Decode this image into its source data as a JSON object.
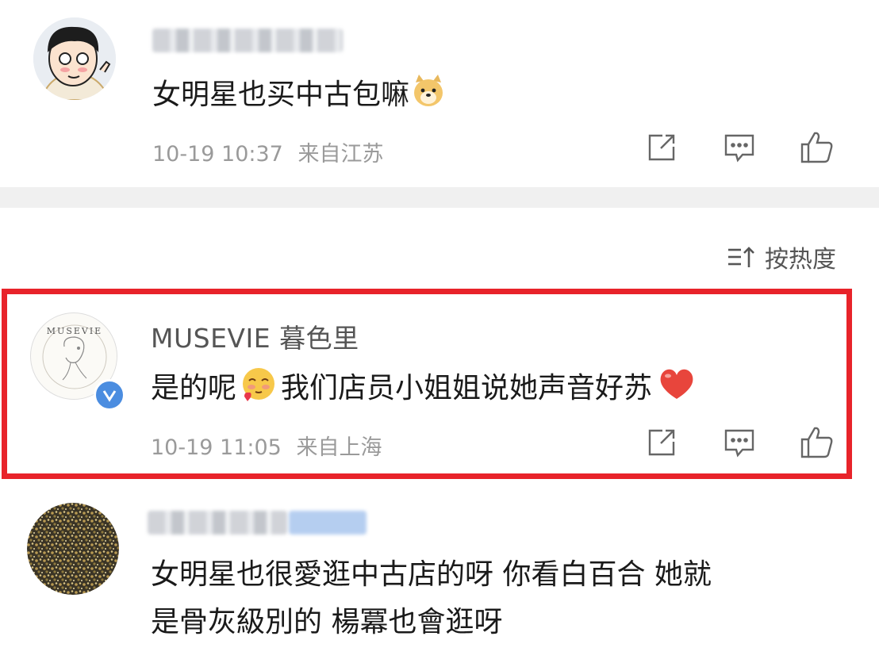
{
  "comments": [
    {
      "username": "",
      "text": "女明星也买中古包嘛",
      "time": "10-19 10:37",
      "location": "来自江苏"
    },
    {
      "username": "MUSEVIE 暮色里",
      "text_a": "是的呢",
      "text_b": "我们店员小姐姐说她声音好苏",
      "time": "10-19 11:05",
      "location": "来自上海",
      "avatar_text": "MUSEVIE",
      "verified": true
    },
    {
      "username": "",
      "line1": "女明星也很愛逛中古店的呀 你看白百合 她就",
      "line2": "是骨灰級別的 楊冪也會逛呀"
    }
  ],
  "sort": {
    "label": "按热度"
  },
  "colors": {
    "highlight": "#e8232a",
    "verified": "#4b8de0",
    "meta": "#9a9a9a"
  },
  "icons": [
    "repost-icon",
    "comment-icon",
    "like-icon",
    "sort-icon",
    "dog-emoji-icon",
    "blush-emoji-icon",
    "heart-emoji-icon",
    "verified-badge-icon"
  ]
}
